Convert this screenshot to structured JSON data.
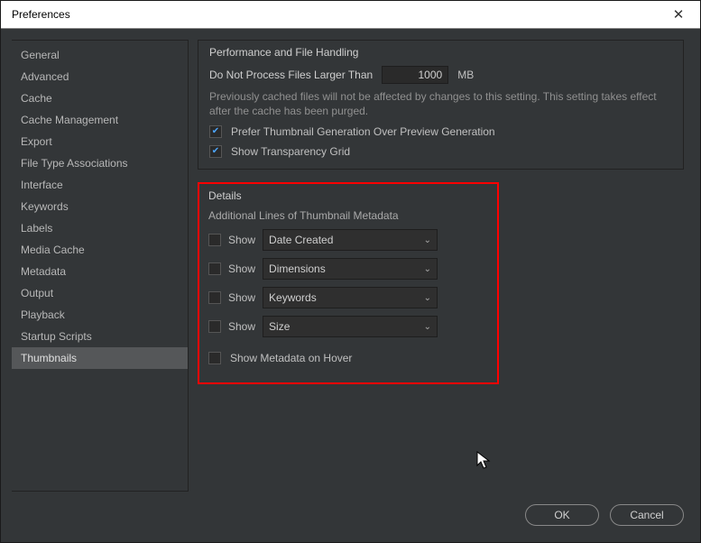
{
  "window": {
    "title": "Preferences"
  },
  "sidebar": {
    "items": [
      {
        "label": "General"
      },
      {
        "label": "Advanced"
      },
      {
        "label": "Cache"
      },
      {
        "label": "Cache Management"
      },
      {
        "label": "Export"
      },
      {
        "label": "File Type Associations"
      },
      {
        "label": "Interface"
      },
      {
        "label": "Keywords"
      },
      {
        "label": "Labels"
      },
      {
        "label": "Media Cache"
      },
      {
        "label": "Metadata"
      },
      {
        "label": "Output"
      },
      {
        "label": "Playback"
      },
      {
        "label": "Startup Scripts"
      },
      {
        "label": "Thumbnails"
      }
    ],
    "selected_index": 14
  },
  "perf": {
    "caption": "Performance and File Handling",
    "limit_label": "Do Not Process Files Larger Than",
    "limit_value": "1000",
    "limit_unit": "MB",
    "note": "Previously cached files will not be affected by changes to this setting. This setting takes effect after the cache has been purged.",
    "prefer_thumb_label": "Prefer Thumbnail Generation Over Preview Generation",
    "prefer_thumb_checked": true,
    "transparency_label": "Show Transparency Grid",
    "transparency_checked": true
  },
  "details": {
    "caption": "Details",
    "sub_caption": "Additional Lines of Thumbnail Metadata",
    "show_label": "Show",
    "rows": [
      {
        "checked": false,
        "value": "Date Created"
      },
      {
        "checked": false,
        "value": "Dimensions"
      },
      {
        "checked": false,
        "value": "Keywords"
      },
      {
        "checked": false,
        "value": "Size"
      }
    ],
    "hover_label": "Show Metadata on Hover",
    "hover_checked": false
  },
  "buttons": {
    "ok": "OK",
    "cancel": "Cancel"
  }
}
